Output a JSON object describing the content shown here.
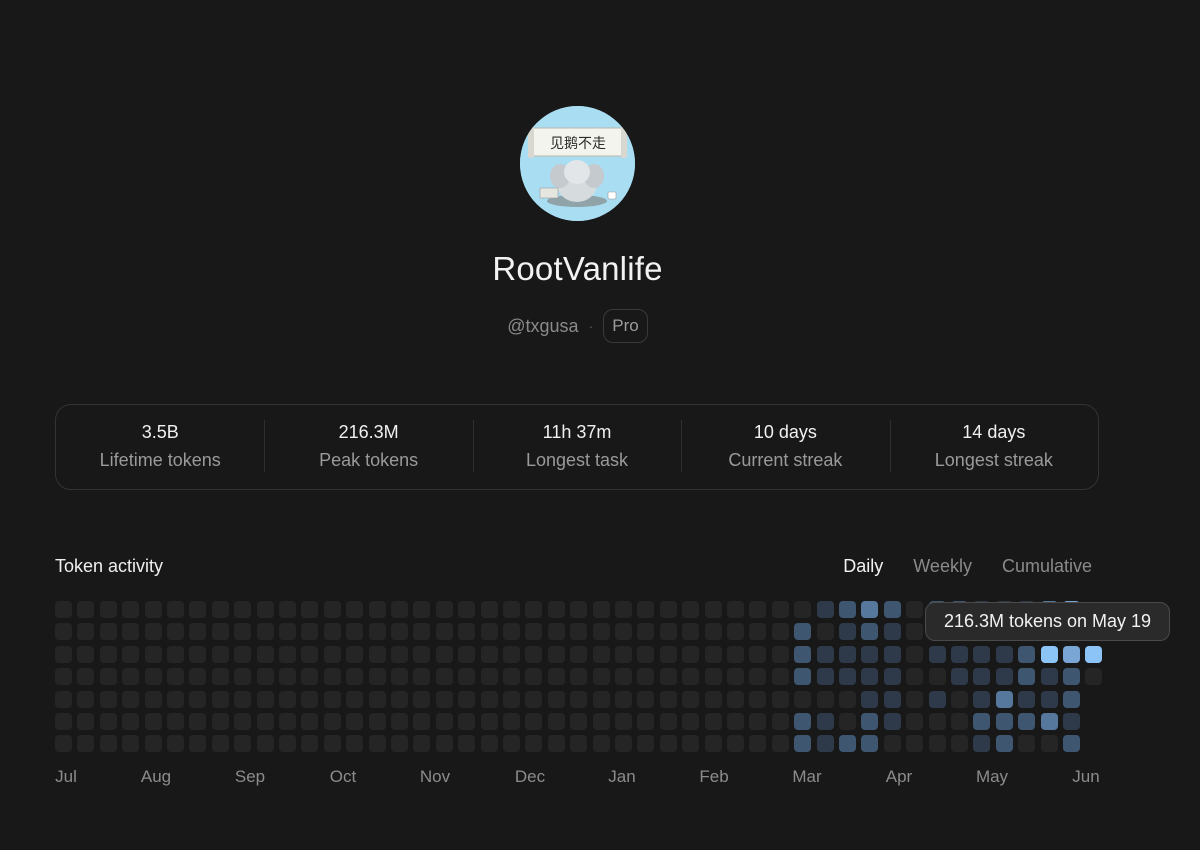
{
  "profile": {
    "name": "RootVanlife",
    "handle": "@txgusa",
    "plan": "Pro",
    "avatar_text": "见鹅不走"
  },
  "stats": [
    {
      "value": "3.5B",
      "label": "Lifetime tokens"
    },
    {
      "value": "216.3M",
      "label": "Peak tokens"
    },
    {
      "value": "11h 37m",
      "label": "Longest task"
    },
    {
      "value": "10 days",
      "label": "Current streak"
    },
    {
      "value": "14 days",
      "label": "Longest streak"
    }
  ],
  "activity": {
    "title": "Token activity",
    "tabs": [
      {
        "label": "Daily",
        "active": true
      },
      {
        "label": "Weekly",
        "active": false
      },
      {
        "label": "Cumulative",
        "active": false
      }
    ],
    "months": [
      "Jul",
      "Aug",
      "Sep",
      "Oct",
      "Nov",
      "Dec",
      "Jan",
      "Feb",
      "Mar",
      "Apr",
      "May",
      "Jun"
    ],
    "tooltip": "216.3M tokens on May 19",
    "levels": [
      [
        0,
        0,
        0,
        0,
        0,
        0,
        0,
        0,
        0,
        0,
        0,
        0,
        0,
        0,
        0,
        0,
        0,
        0,
        0,
        0,
        0,
        0,
        0,
        0,
        0,
        0,
        0,
        0,
        0,
        0,
        0,
        0,
        0,
        0,
        0,
        0,
        0,
        0,
        0,
        0,
        0,
        0,
        0,
        0,
        0,
        0,
        0,
        0,
        0
      ],
      [
        0,
        0,
        0,
        0,
        0,
        0,
        0,
        0,
        0,
        0,
        0,
        0,
        0,
        0,
        0,
        0,
        0,
        0,
        0,
        0,
        0,
        0,
        0,
        0,
        0,
        0,
        0,
        0,
        0,
        0,
        0,
        0,
        0,
        0,
        0,
        0,
        0,
        0,
        0,
        0,
        0,
        0,
        0,
        0,
        0,
        0,
        0,
        0,
        0
      ],
      [
        0,
        0,
        0,
        0,
        0,
        0,
        0,
        0,
        0,
        0,
        0,
        0,
        0,
        0,
        0,
        0,
        0,
        0,
        0,
        0,
        0,
        0,
        0,
        0,
        0,
        0,
        0,
        0,
        0,
        0,
        0,
        0,
        0,
        0,
        0,
        0,
        0,
        0,
        0,
        0,
        0,
        0,
        0,
        0,
        0,
        0,
        0,
        0,
        0
      ],
      [
        0,
        0,
        0,
        0,
        0,
        0,
        0,
        0,
        0,
        0,
        0,
        0,
        0,
        0,
        0,
        0,
        0,
        0,
        0,
        0,
        0,
        0,
        0,
        0,
        0,
        0,
        0,
        0,
        0,
        0,
        0,
        0,
        0,
        0,
        0,
        0,
        0,
        0,
        0,
        0,
        0,
        0,
        0,
        0,
        0,
        0,
        0,
        0,
        0
      ],
      [
        0,
        0,
        0,
        0,
        0,
        0,
        0,
        0,
        0,
        0,
        0,
        0,
        0,
        0,
        0,
        0,
        0,
        0,
        0,
        0,
        0,
        0,
        0,
        0,
        0,
        0,
        0,
        0,
        0,
        0,
        0,
        0,
        0,
        0,
        0,
        0,
        0,
        0,
        0,
        0,
        0,
        0,
        0,
        0,
        0,
        0,
        0,
        0,
        0
      ],
      [
        0,
        0,
        0,
        0,
        0,
        0,
        0,
        0,
        0,
        0,
        0,
        0,
        0,
        0,
        0,
        0,
        0,
        0,
        0,
        0,
        0,
        0,
        0,
        0,
        0,
        0,
        0,
        0,
        0,
        0,
        0,
        0,
        0,
        0,
        0,
        0,
        0,
        0,
        0,
        0,
        0,
        0,
        0,
        0,
        0,
        0,
        0,
        0,
        0
      ],
      [
        0,
        0,
        0,
        0,
        0,
        0,
        0,
        0,
        0,
        0,
        0,
        0,
        0,
        0,
        0,
        0,
        0,
        0,
        0,
        0,
        0,
        0,
        0,
        0,
        0,
        0,
        0,
        0,
        0,
        0,
        0,
        0,
        0,
        0,
        0,
        0,
        0,
        0,
        0,
        0,
        0,
        0,
        0,
        0,
        0,
        0,
        0,
        0,
        0
      ]
    ],
    "recent": [
      [
        0,
        1,
        2,
        3,
        2,
        0,
        2,
        2,
        1,
        1,
        1,
        3,
        4
      ],
      [
        2,
        0,
        1,
        2,
        1,
        0,
        1,
        1,
        1,
        1,
        1,
        1,
        1
      ],
      [
        2,
        1,
        1,
        1,
        1,
        0,
        1,
        1,
        1,
        1,
        2,
        5,
        4,
        5
      ],
      [
        2,
        1,
        1,
        1,
        1,
        0,
        0,
        1,
        1,
        1,
        2,
        1,
        2,
        0
      ],
      [
        0,
        0,
        0,
        1,
        1,
        0,
        1,
        0,
        1,
        3,
        1,
        1,
        2
      ],
      [
        2,
        1,
        0,
        2,
        1,
        0,
        0,
        0,
        2,
        2,
        2,
        3,
        1
      ],
      [
        2,
        1,
        2,
        2,
        0,
        0,
        0,
        0,
        1,
        2,
        0,
        0,
        2
      ]
    ],
    "colors": [
      "#252525",
      "#2e3a4a",
      "#3e5670",
      "#56789c",
      "#7aa6d6",
      "#8cc4f7"
    ]
  }
}
